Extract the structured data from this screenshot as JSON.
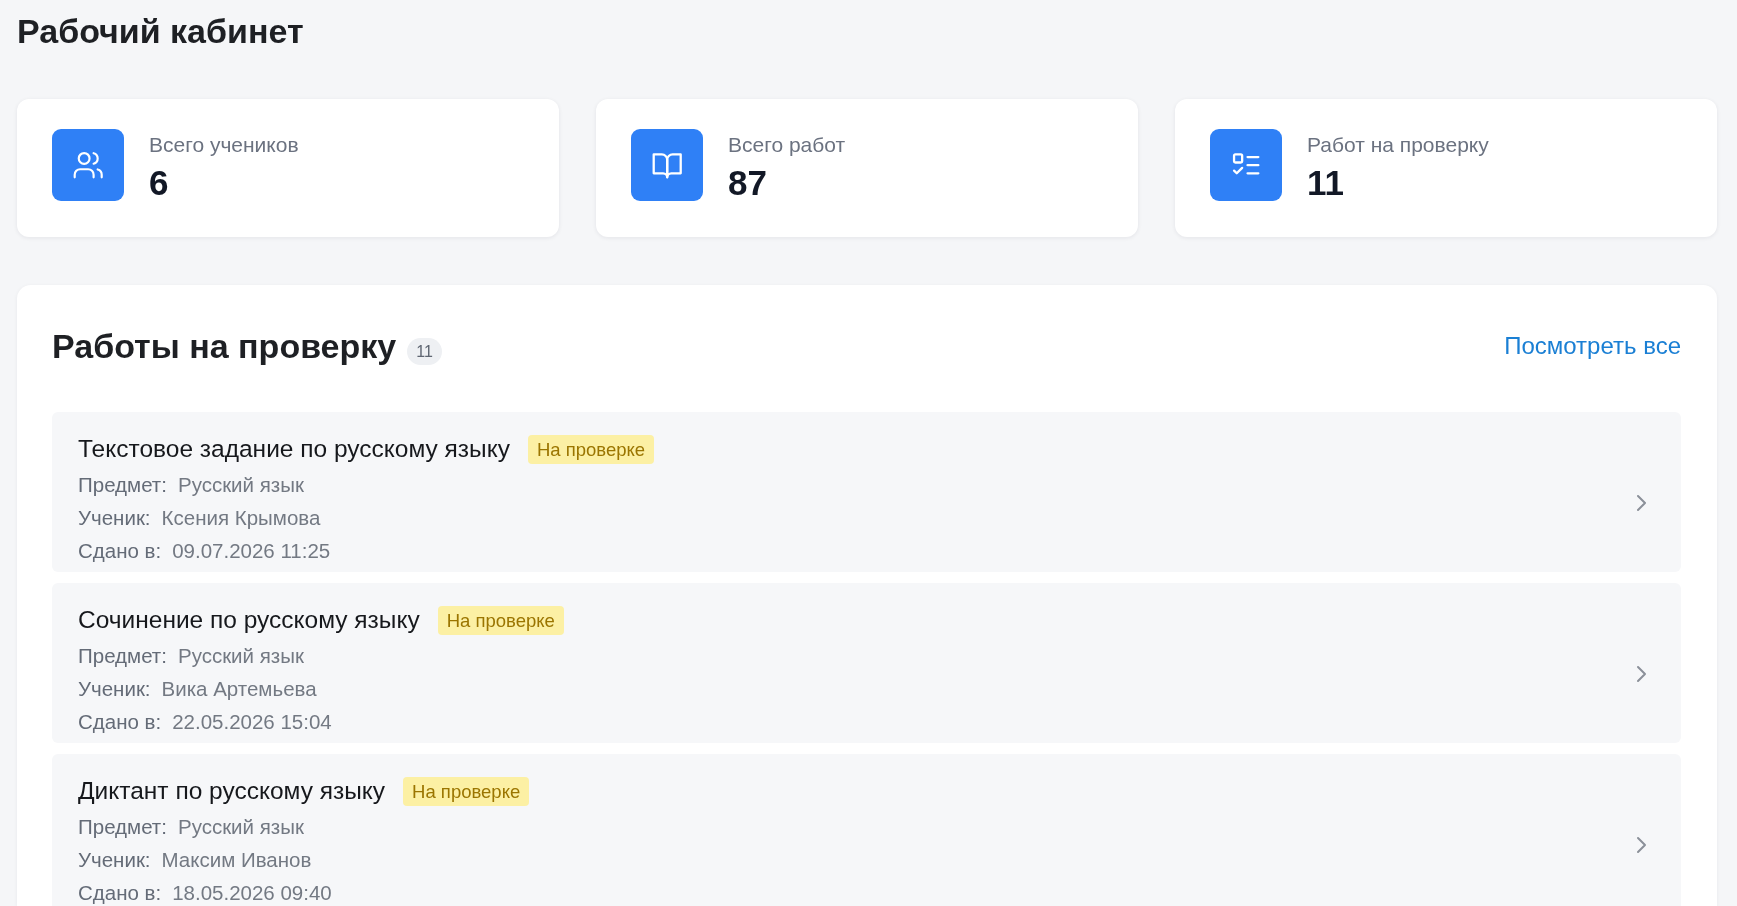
{
  "page": {
    "title": "Рабочий кабинет"
  },
  "stats": [
    {
      "kind": "users",
      "label": "Всего учеников",
      "value": "6"
    },
    {
      "kind": "book",
      "label": "Всего работ",
      "value": "87"
    },
    {
      "kind": "checklist",
      "label": "Работ на проверку",
      "value": "11"
    }
  ],
  "review": {
    "title": "Работы на проверку",
    "count": "11",
    "link": "Посмотреть все",
    "items": [
      {
        "title": "Текстовое задание по русскому языку",
        "status": "На проверке",
        "fields": [
          {
            "label": "Предмет:",
            "value": "Русский язык"
          },
          {
            "label": "Ученик:",
            "value": "Ксения Крымова"
          },
          {
            "label": "Сдано в:",
            "value": "09.07.2026 11:25"
          }
        ]
      },
      {
        "title": "Сочинение по русскому языку",
        "status": "На проверке",
        "fields": [
          {
            "label": "Предмет:",
            "value": "Русский язык"
          },
          {
            "label": "Ученик:",
            "value": "Вика Артемьева"
          },
          {
            "label": "Сдано в:",
            "value": "22.05.2026 15:04"
          }
        ]
      },
      {
        "title": "Диктант по русскому языку",
        "status": "На проверке",
        "fields": [
          {
            "label": "Предмет:",
            "value": "Русский язык"
          },
          {
            "label": "Ученик:",
            "value": "Максим Иванов"
          },
          {
            "label": "Сдано в:",
            "value": "18.05.2026 09:40"
          }
        ]
      }
    ]
  }
}
